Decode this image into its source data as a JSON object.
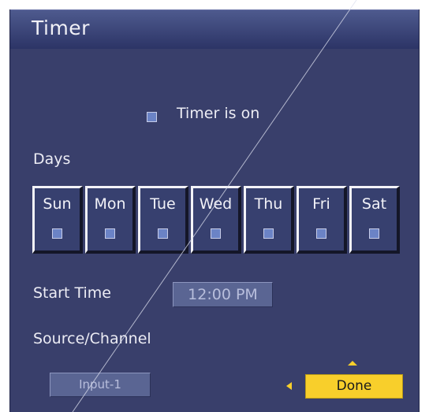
{
  "window": {
    "title": "Timer"
  },
  "timer_toggle": {
    "label": "Timer is on",
    "checked": false
  },
  "days": {
    "heading": "Days",
    "items": [
      {
        "label": "Sun",
        "checked": false
      },
      {
        "label": "Mon",
        "checked": false
      },
      {
        "label": "Tue",
        "checked": false
      },
      {
        "label": "Wed",
        "checked": false
      },
      {
        "label": "Thu",
        "checked": false
      },
      {
        "label": "Fri",
        "checked": false
      },
      {
        "label": "Sat",
        "checked": false
      }
    ]
  },
  "start_time": {
    "label": "Start Time",
    "value": "12:00 PM"
  },
  "source": {
    "label": "Source/Channel",
    "value": "Input-1"
  },
  "actions": {
    "done_label": "Done"
  },
  "colors": {
    "panel_bg": "#393f6b",
    "accent": "#f8cf2b",
    "checkbox": "#6b83c6"
  }
}
